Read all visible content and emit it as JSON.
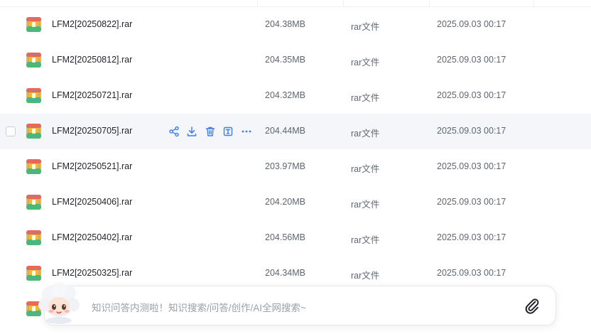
{
  "files": [
    {
      "name": "LFM2[20250822].rar",
      "size": "204.38MB",
      "type": "rar文件",
      "date": "2025.09.03 00:17"
    },
    {
      "name": "LFM2[20250812].rar",
      "size": "204.35MB",
      "type": "rar文件",
      "date": "2025.09.03 00:17"
    },
    {
      "name": "LFM2[20250721].rar",
      "size": "204.32MB",
      "type": "rar文件",
      "date": "2025.09.03 00:17"
    },
    {
      "name": "LFM2[20250705].rar",
      "size": "204.44MB",
      "type": "rar文件",
      "date": "2025.09.03 00:17"
    },
    {
      "name": "LFM2[20250521].rar",
      "size": "203.97MB",
      "type": "rar文件",
      "date": "2025.09.03 00:17"
    },
    {
      "name": "LFM2[20250406].rar",
      "size": "204.20MB",
      "type": "rar文件",
      "date": "2025.09.03 00:17"
    },
    {
      "name": "LFM2[20250402].rar",
      "size": "204.56MB",
      "type": "rar文件",
      "date": "2025.09.03 00:17"
    },
    {
      "name": "LFM2[20250325].rar",
      "size": "204.34MB",
      "type": "rar文件",
      "date": "2025.09.03 00:17"
    }
  ],
  "hovered_row": 3,
  "row_actions": [
    "share-icon",
    "download-icon",
    "delete-icon",
    "text-recognize-icon",
    "more-icon"
  ],
  "ai_bar": {
    "placeholder": "知识问答内测啦！知识搜索/问答/创作/AI全网搜索~",
    "attach_icon": "paperclip-icon",
    "mascot_icon": "cloud-mascot-icon"
  },
  "colors": {
    "accent": "#3d7cf2",
    "hover_row": "#f4f6fa",
    "text_secondary": "#5f6670",
    "placeholder": "#9aa0a8"
  }
}
